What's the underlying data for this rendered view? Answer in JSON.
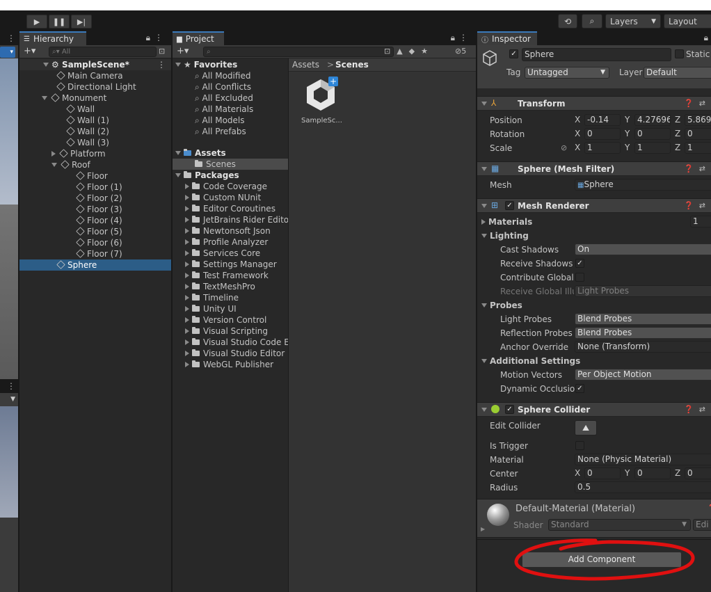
{
  "toolbar": {
    "play_icon": "play-icon",
    "pause_icon": "pause-icon",
    "step_icon": "step-icon",
    "layers_label": "Layers",
    "layout_label": "Layout"
  },
  "hierarchy": {
    "tab_label": "Hierarchy",
    "search_placeholder": "All",
    "scene": "SampleScene*",
    "items": [
      {
        "label": "Main Camera"
      },
      {
        "label": "Directional Light"
      },
      {
        "label": "Monument"
      },
      {
        "label": "Wall"
      },
      {
        "label": "Wall (1)"
      },
      {
        "label": "Wall (2)"
      },
      {
        "label": "Wall (3)"
      },
      {
        "label": "Platform"
      },
      {
        "label": "Roof"
      },
      {
        "label": "Floor"
      },
      {
        "label": "Floor (1)"
      },
      {
        "label": "Floor (2)"
      },
      {
        "label": "Floor (3)"
      },
      {
        "label": "Floor (4)"
      },
      {
        "label": "Floor (5)"
      },
      {
        "label": "Floor (6)"
      },
      {
        "label": "Floor (7)"
      },
      {
        "label": "Sphere"
      }
    ]
  },
  "project": {
    "tab_label": "Project",
    "hidden_count": "5",
    "favorites_label": "Favorites",
    "favorites": [
      "All Modified",
      "All Conflicts",
      "All Excluded",
      "All Materials",
      "All Models",
      "All Prefabs"
    ],
    "assets_label": "Assets",
    "scenes_label": "Scenes",
    "packages_label": "Packages",
    "packages": [
      "Code Coverage",
      "Custom NUnit",
      "Editor Coroutines",
      "JetBrains Rider Editor",
      "Newtonsoft Json",
      "Profile Analyzer",
      "Services Core",
      "Settings Manager",
      "Test Framework",
      "TextMeshPro",
      "Timeline",
      "Unity UI",
      "Version Control",
      "Visual Scripting",
      "Visual Studio Code Editor",
      "Visual Studio Editor",
      "WebGL Publisher"
    ],
    "breadcrumb_root": "Assets",
    "breadcrumb_sep": ">",
    "breadcrumb_current": "Scenes",
    "asset_name": "SampleSc..."
  },
  "inspector": {
    "tab_label": "Inspector",
    "object_name": "Sphere",
    "static_label": "Static",
    "tag_label": "Tag",
    "tag_value": "Untagged",
    "layer_label": "Layer",
    "layer_value": "Default",
    "transform": {
      "title": "Transform",
      "position_label": "Position",
      "rotation_label": "Rotation",
      "scale_label": "Scale",
      "position": [
        "-0.14",
        "4.27696",
        "5.869"
      ],
      "rotation": [
        "0",
        "0",
        "0"
      ],
      "scale": [
        "1",
        "1",
        "1"
      ]
    },
    "mesh_filter": {
      "title": "Sphere (Mesh Filter)",
      "mesh_label": "Mesh",
      "mesh_value": "Sphere"
    },
    "mesh_renderer": {
      "title": "Mesh Renderer",
      "materials_label": "Materials",
      "materials_count": "1",
      "lighting_label": "Lighting",
      "cast_shadows_label": "Cast Shadows",
      "cast_shadows_value": "On",
      "receive_shadows_label": "Receive Shadows",
      "contribute_gi_label": "Contribute Global Il",
      "receive_gi_label": "Receive Global Illu",
      "receive_gi_value": "Light Probes",
      "probes_label": "Probes",
      "light_probes_label": "Light Probes",
      "light_probes_value": "Blend Probes",
      "reflection_probes_label": "Reflection Probes",
      "reflection_probes_value": "Blend Probes",
      "anchor_override_label": "Anchor Override",
      "anchor_override_value": "None (Transform)",
      "additional_label": "Additional Settings",
      "motion_vectors_label": "Motion Vectors",
      "motion_vectors_value": "Per Object Motion",
      "dynamic_occlusion_label": "Dynamic Occlusior"
    },
    "sphere_collider": {
      "title": "Sphere Collider",
      "edit_collider_label": "Edit Collider",
      "is_trigger_label": "Is Trigger",
      "material_label": "Material",
      "material_value": "None (Physic Material)",
      "center_label": "Center",
      "center": [
        "0",
        "0",
        "0"
      ],
      "radius_label": "Radius",
      "radius_value": "0.5"
    },
    "material": {
      "title": "Default-Material (Material)",
      "shader_label": "Shader",
      "shader_value": "Standard",
      "edit_label": "Edi"
    },
    "add_component_label": "Add Component",
    "axes": [
      "X",
      "Y",
      "Z"
    ]
  },
  "colors": {
    "selection": "#2c5d87",
    "annotation": "#e01010",
    "panel": "#282828",
    "header": "#3e3e3e"
  }
}
